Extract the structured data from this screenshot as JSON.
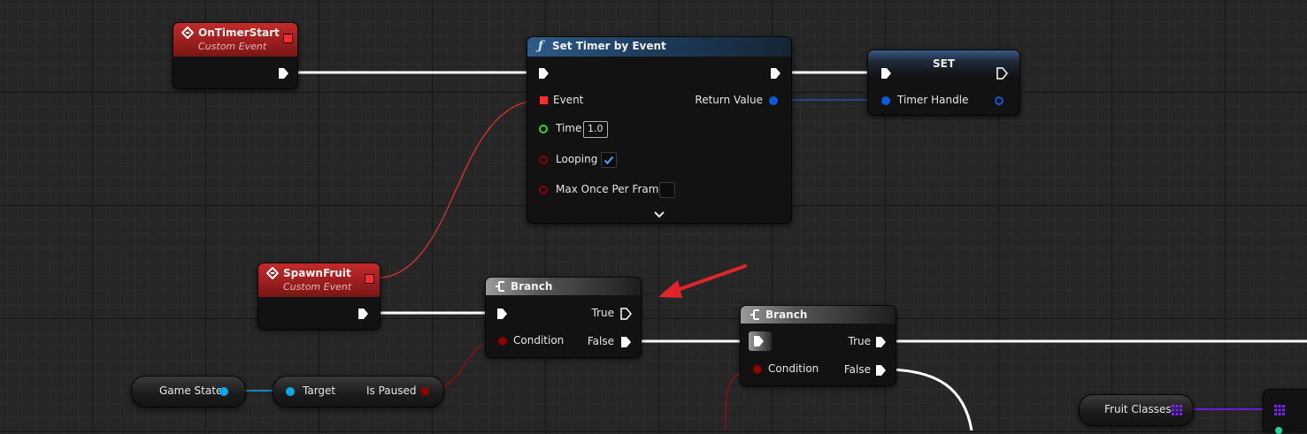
{
  "nodes": {
    "on_timer_start": {
      "title": "OnTimerStart",
      "subtitle": "Custom Event"
    },
    "set_timer": {
      "title": "Set Timer by Event",
      "event_label": "Event",
      "return_label": "Return Value",
      "time_label": "Time",
      "time_value": "1.0",
      "looping_label": "Looping",
      "looping_checked": true,
      "max_once_label": "Max Once Per Frame",
      "max_once_checked": false
    },
    "set_node": {
      "title": "SET",
      "handle_label": "Timer Handle"
    },
    "spawn_fruit": {
      "title": "SpawnFruit",
      "subtitle": "Custom Event"
    },
    "branch_1": {
      "title": "Branch",
      "true_label": "True",
      "false_label": "False",
      "condition_label": "Condition"
    },
    "branch_2": {
      "title": "Branch",
      "true_label": "True",
      "false_label": "False",
      "condition_label": "Condition"
    },
    "game_state": {
      "label": "Game State"
    },
    "is_paused_getter": {
      "target_label": "Target",
      "output_label": "Is Paused"
    },
    "fruit_classes": {
      "label": "Fruit Classes"
    }
  },
  "colors": {
    "exec": "#ffffff",
    "delegate": "#ff2b2b",
    "float": "#3ad13a",
    "bool": "#8c0000",
    "struct": "#0b5bd8",
    "object": "#0aa8e8",
    "class_array": "#7a22ff"
  },
  "icons": {
    "event": "event-diamond-icon",
    "function": "function-f-icon",
    "branch": "branch-icon",
    "annotation": "red-arrow-icon"
  }
}
